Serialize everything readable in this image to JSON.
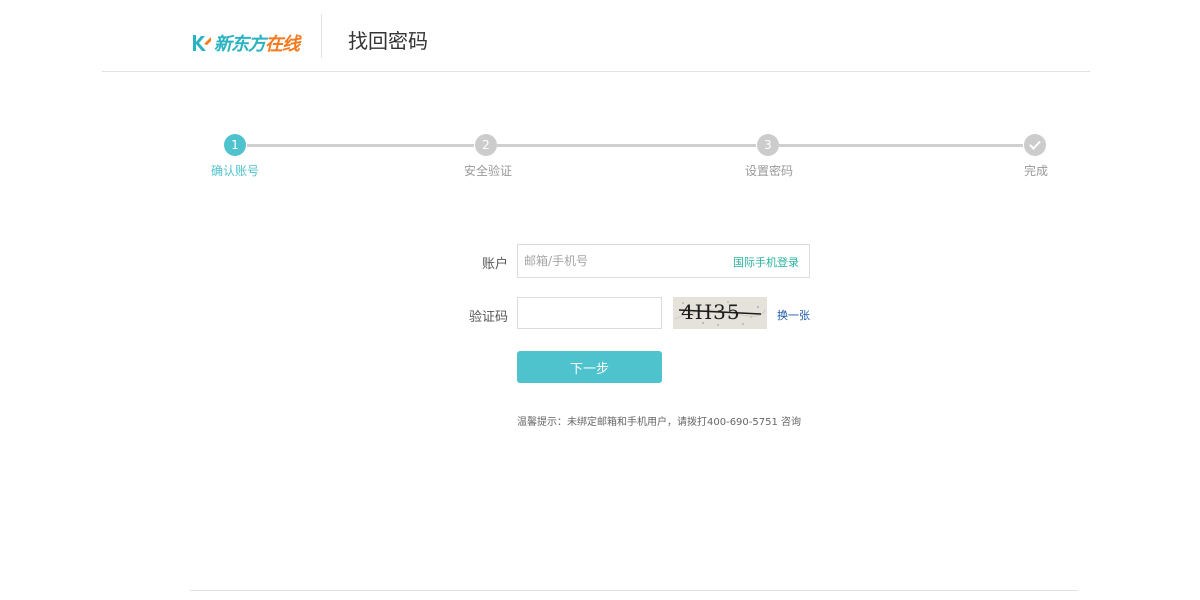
{
  "header": {
    "logo_part1": "新东方",
    "logo_part2": "在线",
    "title": "找回密码"
  },
  "steps": [
    {
      "number": "1",
      "label": "确认账号",
      "active": true
    },
    {
      "number": "2",
      "label": "安全验证",
      "active": false
    },
    {
      "number": "3",
      "label": "设置密码",
      "active": false
    },
    {
      "number": "",
      "label": "完成",
      "active": false
    }
  ],
  "form": {
    "account_label": "账户",
    "account_value": "",
    "account_placeholder": "邮箱/手机号",
    "intl_login": "国际手机登录",
    "captcha_label": "验证码",
    "captcha_value": "",
    "captcha_text": "4H35",
    "refresh_label": "换一张",
    "next_label": "下一步"
  },
  "hint": "温馨提示：未绑定邮箱和手机用户，请拨打400-690-5751 咨询",
  "colors": {
    "accent": "#4fc3cd",
    "brand_teal": "#2ab3c0",
    "brand_orange": "#f47a20",
    "link_blue": "#1e5aa8"
  },
  "icons": {
    "logo": "brand-logo-icon",
    "done": "check-icon"
  }
}
